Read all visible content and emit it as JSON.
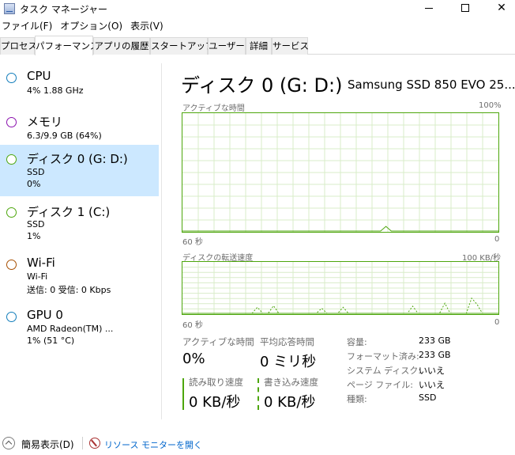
{
  "window": {
    "title": "タスク マネージャー",
    "minimize": "minimize",
    "maximize": "maximize",
    "close": "✕"
  },
  "menu": [
    "ファイル(F)",
    "オプション(O)",
    "表示(V)"
  ],
  "tabs": [
    "プロセス",
    "パフォーマンス",
    "アプリの履歴",
    "スタートアップ",
    "ユーザー",
    "詳細",
    "サービス"
  ],
  "active_tab": "パフォーマンス",
  "sidebar": {
    "items": [
      {
        "name": "CPU",
        "line1": "4%  1.88 GHz",
        "line2": "",
        "color": "#117dbb"
      },
      {
        "name": "メモリ",
        "line1": "6.3/9.9 GB (64%)",
        "line2": "",
        "color": "#8b12ae"
      },
      {
        "name": "ディスク 0 (G: D:)",
        "line1": "SSD",
        "line2": "0%",
        "color": "#4da60c",
        "selected": true
      },
      {
        "name": "ディスク 1 (C:)",
        "line1": "SSD",
        "line2": "1%",
        "color": "#4da60c"
      },
      {
        "name": "Wi-Fi",
        "line1": "Wi-Fi",
        "line2": "送信: 0 受信: 0 Kbps",
        "color": "#a74f01"
      },
      {
        "name": "GPU 0",
        "line1": "AMD Radeon(TM) ...",
        "line2": "1% (51 °C)",
        "color": "#117dbb"
      }
    ]
  },
  "main": {
    "title": "ディスク 0 (G: D:)",
    "model": "Samsung SSD 850 EVO 25...",
    "graph1": {
      "label": "アクティブな時間",
      "max_label": "100%",
      "x_left": "60 秒",
      "x_right": "0",
      "values": [
        0,
        0,
        0,
        0,
        0,
        0,
        0,
        0,
        0,
        0,
        0,
        0,
        0,
        0,
        0,
        0,
        0,
        0,
        0,
        0,
        0,
        0,
        0,
        0,
        0,
        0,
        0,
        0,
        0,
        0,
        0,
        0,
        0,
        0,
        0,
        0,
        0,
        0,
        4,
        0,
        0,
        0,
        0,
        0,
        0,
        0,
        0,
        0,
        0,
        0,
        0,
        0,
        0,
        0,
        0,
        0,
        0,
        0,
        0,
        0
      ],
      "ymax": 100
    },
    "graph2": {
      "label": "ディスクの転送速度",
      "max_label": "100 KB/秒",
      "x_left": "60 秒",
      "x_right": "0",
      "series_read": [
        0,
        0,
        0,
        0,
        0,
        0,
        0,
        0,
        0,
        0,
        0,
        0,
        0,
        0,
        0,
        0,
        0,
        0,
        0,
        0,
        0,
        0,
        0,
        0,
        0,
        0,
        0,
        0,
        0,
        0,
        0,
        0,
        0,
        0,
        0,
        0,
        0,
        0,
        0,
        0,
        0,
        0,
        0,
        0,
        0,
        0,
        0,
        0,
        0,
        0,
        0,
        0,
        0,
        0,
        0,
        0,
        0,
        0,
        0,
        0
      ],
      "series_write": [
        0,
        0,
        0,
        0,
        0,
        0,
        0,
        0,
        0,
        0,
        0,
        0,
        0,
        0,
        12,
        0,
        0,
        15,
        0,
        0,
        0,
        0,
        0,
        0,
        0,
        0,
        10,
        0,
        0,
        0,
        12,
        0,
        0,
        0,
        0,
        0,
        0,
        0,
        0,
        0,
        0,
        0,
        0,
        14,
        0,
        0,
        0,
        0,
        0,
        20,
        0,
        0,
        0,
        0,
        30,
        18,
        0,
        0,
        0,
        0
      ],
      "ymax": 100
    },
    "stats": {
      "active_time_label": "アクティブな時間",
      "active_time_value": "0%",
      "avg_response_label": "平均応答時間",
      "avg_response_value": "0 ミリ秒",
      "read_label": "読み取り速度",
      "read_value": "0 KB/秒",
      "write_label": "書き込み速度",
      "write_value": "0 KB/秒"
    },
    "properties": [
      {
        "label": "容量:",
        "value": "233 GB"
      },
      {
        "label": "フォーマット済み:",
        "value": "233 GB"
      },
      {
        "label": "システム ディスク:",
        "value": "いいえ"
      },
      {
        "label": "ページ ファイル:",
        "value": "いいえ"
      },
      {
        "label": "種類:",
        "value": "SSD"
      }
    ]
  },
  "footer": {
    "fewer_details": "簡易表示(D)",
    "resource_monitor": "リソース モニターを開く"
  },
  "colors": {
    "disk": "#4da60c",
    "selected_bg": "#cce8ff",
    "grid": "#d9ecc9",
    "link": "#0066cc"
  }
}
